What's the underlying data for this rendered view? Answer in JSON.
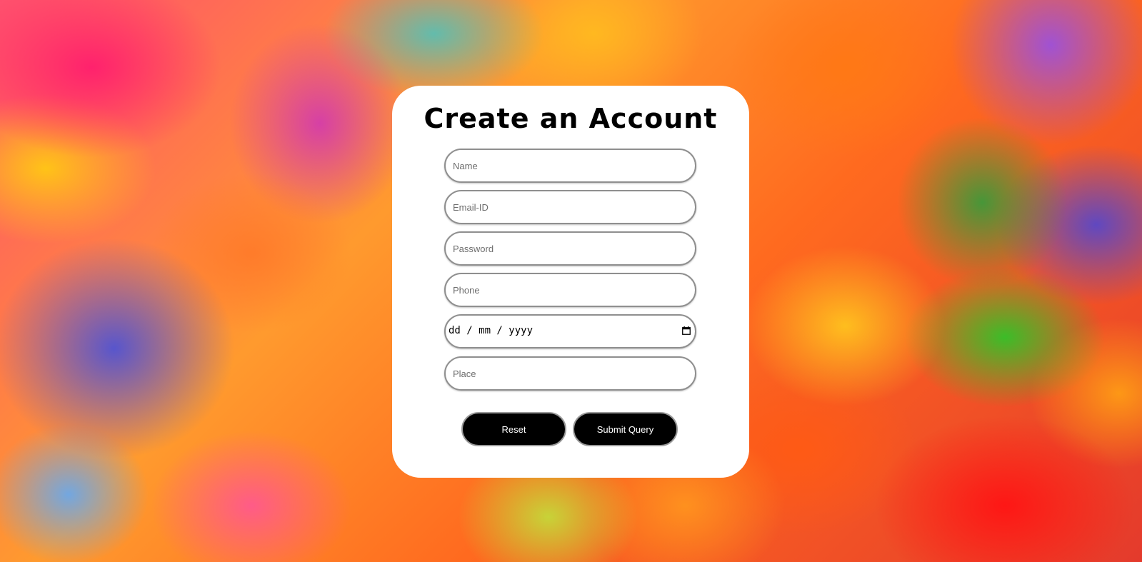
{
  "form": {
    "title": "Create an Account",
    "fields": {
      "name_placeholder": "Name",
      "email_placeholder": "Email-ID",
      "password_placeholder": "Password",
      "phone_placeholder": "Phone",
      "date_value": "dd / mm / yyyy",
      "place_placeholder": "Place"
    },
    "buttons": {
      "reset_label": "Reset",
      "submit_label": "Submit Query"
    }
  },
  "colors": {
    "card_background": "#ffffff",
    "button_background": "#000000",
    "button_text": "#ffffff"
  },
  "icons": {
    "date_picker": "calendar-icon"
  }
}
